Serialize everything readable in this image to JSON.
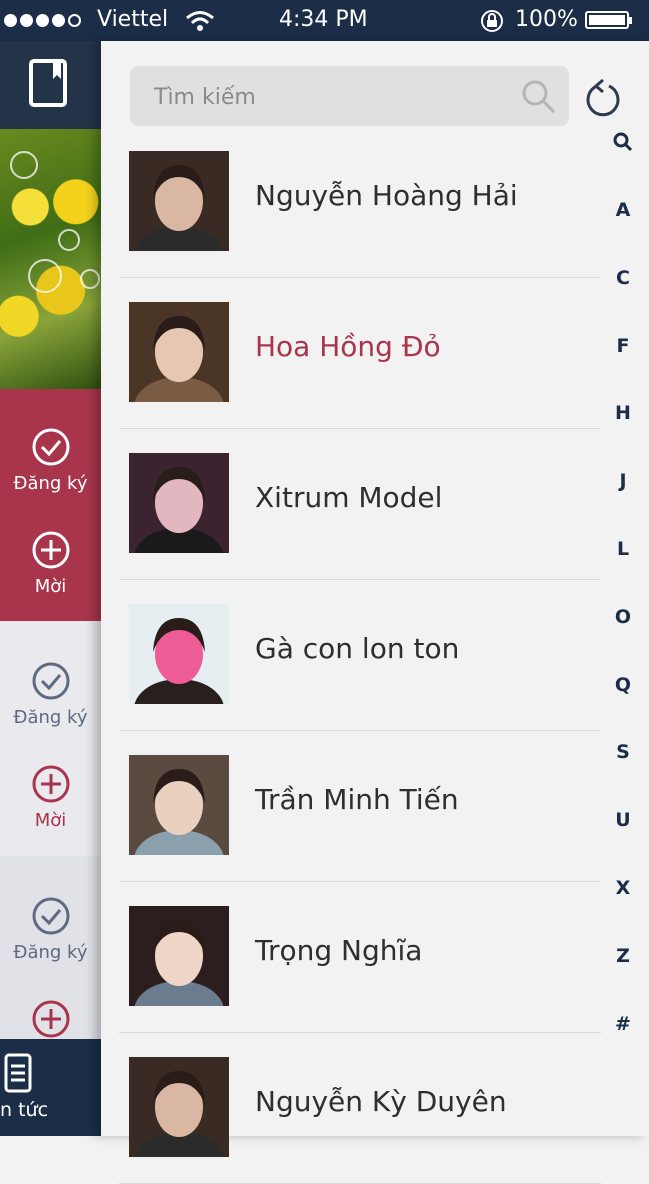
{
  "status_bar": {
    "carrier": "Viettel",
    "time": "4:34 PM",
    "battery": "100%"
  },
  "side_menu": {
    "cards": [
      {
        "register_label": "Đăng ký",
        "invite_label": "Mời"
      },
      {
        "register_label": "Đăng ký",
        "invite_label": "Mời"
      },
      {
        "register_label": "Đăng ký",
        "invite_label": ""
      }
    ],
    "news_label": "n tức"
  },
  "search": {
    "placeholder": "Tìm kiếm"
  },
  "contacts": [
    {
      "name": "Nguyễn Hoàng Hải",
      "highlighted": false
    },
    {
      "name": "Hoa Hồng Đỏ",
      "highlighted": true
    },
    {
      "name": "Xitrum Model",
      "highlighted": false
    },
    {
      "name": "Gà con lon ton",
      "highlighted": false
    },
    {
      "name": "Trần Minh Tiến",
      "highlighted": false
    },
    {
      "name": "Trọng Nghĩa",
      "highlighted": false
    },
    {
      "name": "Nguyễn Kỳ Duyên",
      "highlighted": false
    }
  ],
  "index_letters": [
    "A",
    "C",
    "F",
    "H",
    "J",
    "L",
    "O",
    "Q",
    "S",
    "U",
    "X",
    "Z",
    "#"
  ],
  "colors": {
    "accent": "#a8354b",
    "navy": "#1b2d47"
  }
}
